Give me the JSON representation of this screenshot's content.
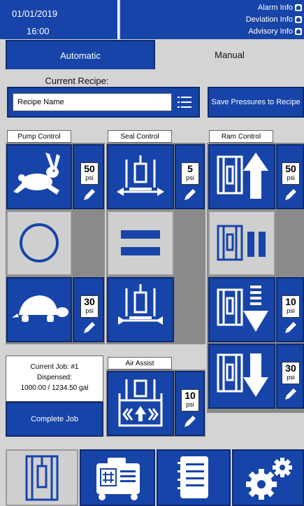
{
  "header": {
    "date": "01/01/2019",
    "time": "16:00",
    "alarm_info": "Alarm Info",
    "deviation_info": "Deviation Info",
    "advisory_info": "Advisory Info"
  },
  "tabs": {
    "automatic": "Automatic",
    "manual": "Manual"
  },
  "recipe": {
    "label": "Current Recipe:",
    "name": "Recipe Name",
    "list_icon": "list-icon",
    "save_button": "Save Pressures to Recipe"
  },
  "pump_control": {
    "label": "Pump Control",
    "fast_psi": "50",
    "slow_psi": "30",
    "unit": "psi"
  },
  "seal_control": {
    "label": "Seal Control",
    "psi": "5",
    "unit": "psi"
  },
  "ram_control": {
    "label": "Ram Control",
    "up_psi": "50",
    "down_slow_psi": "10",
    "down_psi": "30",
    "unit": "psi"
  },
  "air_assist": {
    "label": "Air Assist",
    "psi": "10",
    "unit": "psi"
  },
  "job": {
    "current_job": "Current Job: #1",
    "dispensed_label": "Dispensed:",
    "dispensed_value": "1000.00 / 1234.50  gal",
    "complete_button": "Complete Job"
  },
  "colors": {
    "accent": "#1744a8",
    "panel_bg": "#d4d4d4",
    "button_border": "#0c2a6e"
  },
  "nav_icons": [
    "ram-icon",
    "control-panel-icon",
    "notebook-icon",
    "settings-icon"
  ]
}
